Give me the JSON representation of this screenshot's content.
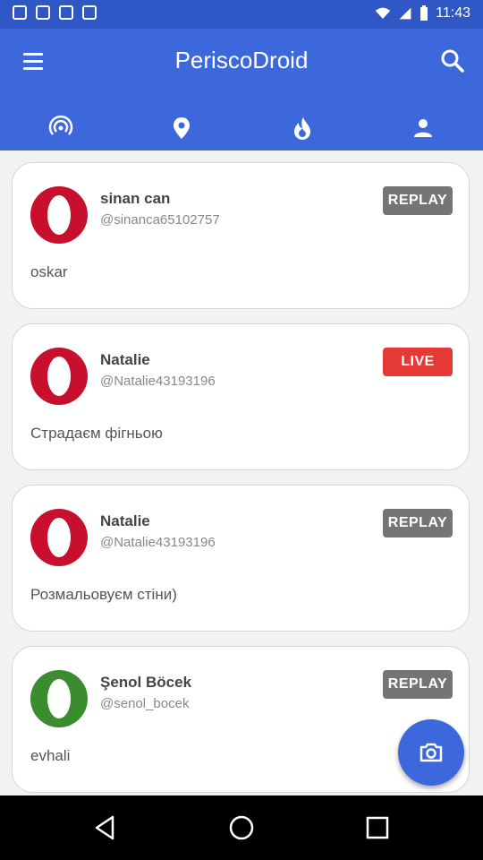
{
  "status_bar": {
    "time": "11:43"
  },
  "app": {
    "title": "PeriscoDroid"
  },
  "tabs": [
    {
      "icon": "broadcast-icon"
    },
    {
      "icon": "location-pin-icon"
    },
    {
      "icon": "flame-icon"
    },
    {
      "icon": "person-icon"
    }
  ],
  "cards": [
    {
      "name": "sinan can",
      "handle": "@sinanca65102757",
      "badge": "REPLAY",
      "description": "oskar",
      "avatar_color": "#c8102e"
    },
    {
      "name": "Natalie",
      "handle": "@Natalie43193196",
      "badge": "LIVE",
      "description": "Страдаєм фігньою",
      "avatar_color": "#c8102e"
    },
    {
      "name": "Natalie",
      "handle": "@Natalie43193196",
      "badge": "REPLAY",
      "description": "Розмальовуєм стіни)",
      "avatar_color": "#c8102e"
    },
    {
      "name": "Şenol Böcek",
      "handle": "@senol_bocek",
      "badge": "REPLAY",
      "description": "evhali",
      "avatar_color": "#3a8c2f"
    }
  ],
  "colors": {
    "primary": "#3d68dc",
    "status_bar": "#2f57c5",
    "live": "#e53935",
    "replay": "#757575"
  }
}
